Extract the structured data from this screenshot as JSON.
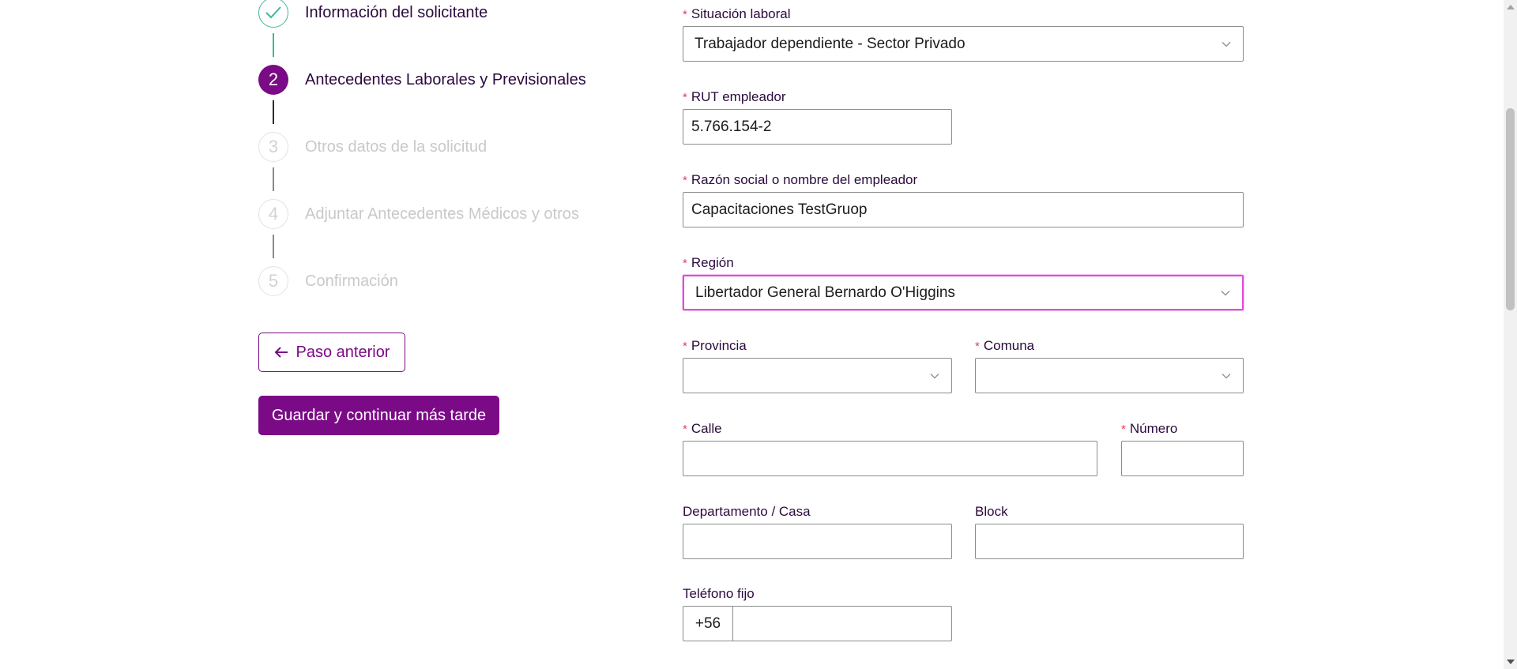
{
  "stepper": {
    "steps": [
      {
        "number": "",
        "label": "Información del solicitante",
        "state": "done"
      },
      {
        "number": "2",
        "label": "Antecedentes Laborales y Previsionales",
        "state": "active"
      },
      {
        "number": "3",
        "label": "Otros datos de la solicitud",
        "state": "pending"
      },
      {
        "number": "4",
        "label": "Adjuntar Antecedentes Médicos y otros",
        "state": "pending"
      },
      {
        "number": "5",
        "label": "Confirmación",
        "state": "pending"
      }
    ]
  },
  "actions": {
    "back_label": "Paso anterior",
    "save_label": "Guardar y continuar más tarde"
  },
  "form": {
    "required_mark": "*",
    "situacion_laboral": {
      "label": "Situación laboral",
      "value": "Trabajador dependiente - Sector Privado"
    },
    "rut_empleador": {
      "label": "RUT empleador",
      "value": "5.766.154-2"
    },
    "razon_social": {
      "label": "Razón social o nombre del empleador",
      "value": "Capacitaciones TestGruop"
    },
    "region": {
      "label": "Región",
      "value": "Libertador General Bernardo O'Higgins"
    },
    "provincia": {
      "label": "Provincia",
      "value": ""
    },
    "comuna": {
      "label": "Comuna",
      "value": ""
    },
    "calle": {
      "label": "Calle",
      "value": ""
    },
    "numero": {
      "label": "Número",
      "value": ""
    },
    "departamento": {
      "label": "Departamento / Casa",
      "value": ""
    },
    "block": {
      "label": "Block",
      "value": ""
    },
    "telefono_fijo": {
      "label": "Teléfono fijo",
      "prefix": "+56",
      "value": ""
    }
  },
  "colors": {
    "brand": "#7a0a86",
    "done": "#3fb89b",
    "required": "#e2405c",
    "focus": "#e04bdc"
  }
}
